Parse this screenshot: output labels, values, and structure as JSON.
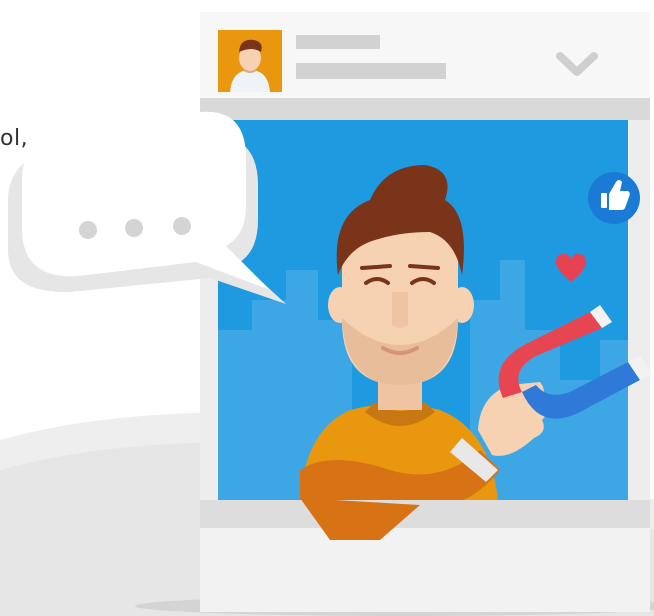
{
  "illustration": {
    "cropped_text": "ol,",
    "speech_bubble": {
      "dots": 3
    },
    "icons": [
      "thumbs-up-icon",
      "heart-icon",
      "magnet-icon",
      "chevron-down-icon"
    ],
    "colors": {
      "sky": "#1e9ae0",
      "city_silhouette": "#3da7e6",
      "card": "#ededed",
      "card_bar": "#d8d8d8",
      "placeholder_lines": "#d0d0d0",
      "hair": "#7a3419",
      "skin": "#f6d1b2",
      "shirt": "#e8970e",
      "sleeve": "#d77315",
      "like_badge": "#1a7bd6",
      "heart": "#e74251",
      "magnet_red": "#e74552",
      "magnet_blue": "#2f7ad8"
    }
  }
}
